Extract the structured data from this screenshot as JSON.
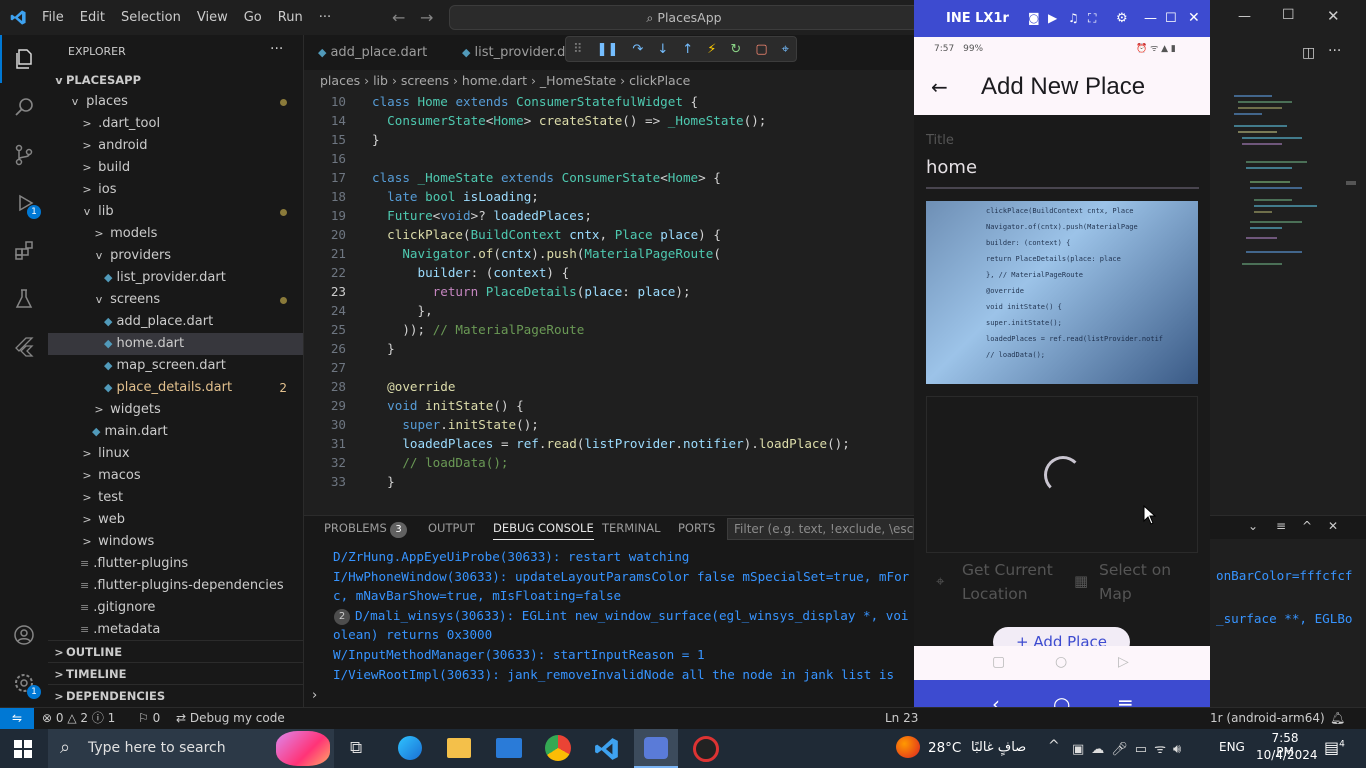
{
  "menu": [
    "File",
    "Edit",
    "Selection",
    "View",
    "Go",
    "Run",
    "···"
  ],
  "search_text": "PlacesApp",
  "explorer": {
    "title": "EXPLORER",
    "root": "PLACESAPP",
    "items": [
      {
        "label": "places",
        "depth": 1,
        "chev": "v",
        "folder": true,
        "dot": true
      },
      {
        "label": ".dart_tool",
        "depth": 2,
        "chev": ">"
      },
      {
        "label": "android",
        "depth": 2,
        "chev": ">"
      },
      {
        "label": "build",
        "depth": 2,
        "chev": ">"
      },
      {
        "label": "ios",
        "depth": 2,
        "chev": ">"
      },
      {
        "label": "lib",
        "depth": 2,
        "chev": "v",
        "dot": true
      },
      {
        "label": "models",
        "depth": 3,
        "chev": ">"
      },
      {
        "label": "providers",
        "depth": 3,
        "chev": "v"
      },
      {
        "label": "list_provider.dart",
        "depth": 4,
        "dart": true
      },
      {
        "label": "screens",
        "depth": 3,
        "chev": "v",
        "dot": true
      },
      {
        "label": "add_place.dart",
        "depth": 4,
        "dart": true
      },
      {
        "label": "home.dart",
        "depth": 4,
        "dart": true,
        "selected": true
      },
      {
        "label": "map_screen.dart",
        "depth": 4,
        "dart": true
      },
      {
        "label": "place_details.dart",
        "depth": 4,
        "dart": true,
        "badge": "2"
      },
      {
        "label": "widgets",
        "depth": 3,
        "chev": ">"
      },
      {
        "label": "main.dart",
        "depth": 3,
        "dart": true
      },
      {
        "label": "linux",
        "depth": 2,
        "chev": ">"
      },
      {
        "label": "macos",
        "depth": 2,
        "chev": ">"
      },
      {
        "label": "test",
        "depth": 2,
        "chev": ">"
      },
      {
        "label": "web",
        "depth": 2,
        "chev": ">"
      },
      {
        "label": "windows",
        "depth": 2,
        "chev": ">"
      },
      {
        "label": ".flutter-plugins",
        "depth": 2,
        "file": true
      },
      {
        "label": ".flutter-plugins-dependencies",
        "depth": 2,
        "file": true
      },
      {
        "label": ".gitignore",
        "depth": 2,
        "file": true
      },
      {
        "label": ".metadata",
        "depth": 2,
        "file": true
      }
    ],
    "sections": [
      "OUTLINE",
      "TIMELINE",
      "DEPENDENCIES"
    ]
  },
  "tabs": [
    "add_place.dart",
    "list_provider.da"
  ],
  "breadcrumb": "places › lib › screens › home.dart › _HomeState › clickPlace",
  "code": [
    {
      "n": "10",
      "html": "<span class='kw'>class</span> <span class='cl'>Home</span> <span class='kw'>extends</span> <span class='cl'>ConsumerStatefulWidget</span> <span class='pu'>{</span>"
    },
    {
      "n": "14",
      "html": "  <span class='cl'>ConsumerState</span><span class='pu'>&lt;</span><span class='cl'>Home</span><span class='pu'>&gt;</span> <span class='fn'>createState</span><span class='pu'>() =&gt;</span> <span class='cl'>_HomeState</span><span class='pu'>();</span>"
    },
    {
      "n": "15",
      "html": "<span class='pu'>}</span>"
    },
    {
      "n": "16",
      "html": ""
    },
    {
      "n": "17",
      "html": "<span class='kw'>class</span> <span class='cl'>_HomeState</span> <span class='kw'>extends</span> <span class='cl'>ConsumerState</span><span class='pu'>&lt;</span><span class='cl'>Home</span><span class='pu'>&gt; {</span>"
    },
    {
      "n": "18",
      "html": "  <span class='kw'>late</span> <span class='cl'>bool</span> <span class='vr'>isLoading</span><span class='pu'>;</span>"
    },
    {
      "n": "19",
      "html": "  <span class='cl'>Future</span><span class='pu'>&lt;</span><span class='kw'>void</span><span class='pu'>&gt;?</span> <span class='vr'>loadedPlaces</span><span class='pu'>;</span>"
    },
    {
      "n": "20",
      "html": "  <span class='fn'>clickPlace</span><span class='pu'>(</span><span class='cl'>BuildContext</span> <span class='vr'>cntx</span><span class='pu'>,</span> <span class='cl'>Place</span> <span class='vr'>place</span><span class='pu'>) {</span>"
    },
    {
      "n": "21",
      "html": "    <span class='cl'>Navigator</span><span class='pu'>.</span><span class='fn'>of</span><span class='pu'>(</span><span class='vr'>cntx</span><span class='pu'>).</span><span class='fn'>push</span><span class='pu'>(</span><span class='cl'>MaterialPageRoute</span><span class='pu'>(</span>"
    },
    {
      "n": "22",
      "html": "      <span class='vr'>builder</span><span class='pu'>: (</span><span class='vr'>context</span><span class='pu'>) {</span>"
    },
    {
      "n": "23",
      "html": "        <span class='ctl'>return</span> <span class='cl'>PlaceDetails</span><span class='pu'>(</span><span class='vr'>place</span><span class='pu'>:</span> <span class='vr'>place</span><span class='pu'>);</span>",
      "cur": true
    },
    {
      "n": "24",
      "html": "      <span class='pu'>},</span>"
    },
    {
      "n": "25",
      "html": "    <span class='pu'>));</span> <span class='cm'>// MaterialPageRoute</span>"
    },
    {
      "n": "26",
      "html": "  <span class='pu'>}</span>"
    },
    {
      "n": "27",
      "html": ""
    },
    {
      "n": "28",
      "html": "  <span class='an'>@override</span>"
    },
    {
      "n": "29",
      "html": "  <span class='kw'>void</span> <span class='fn'>initState</span><span class='pu'>() {</span>"
    },
    {
      "n": "30",
      "html": "    <span class='kw'>super</span><span class='pu'>.</span><span class='fn'>initState</span><span class='pu'>();</span>"
    },
    {
      "n": "31",
      "html": "    <span class='vr'>loadedPlaces</span> <span class='pu'>=</span> <span class='vr'>ref</span><span class='pu'>.</span><span class='fn'>read</span><span class='pu'>(</span><span class='vr'>listProvider</span><span class='pu'>.</span><span class='vr'>notifier</span><span class='pu'>).</span><span class='fn'>loadPlace</span><span class='pu'>();</span>"
    },
    {
      "n": "32",
      "html": "    <span class='cm'>// loadData();</span>"
    },
    {
      "n": "33",
      "html": "  <span class='pu'>}</span>"
    }
  ],
  "panel": {
    "tabs": [
      "PROBLEMS",
      "OUTPUT",
      "DEBUG CONSOLE",
      "TERMINAL",
      "PORTS"
    ],
    "problems_count": "3",
    "filter_placeholder": "Filter (e.g. text, !exclude, \\escape)",
    "lines": [
      "D/ZrHung.AppEyeUiProbe(30633): restart watching",
      "I/HwPhoneWindow(30633): updateLayoutParamsColor false mSpecialSet=true, mFor",
      "c, mNavBarShow=true, mIsFloating=false",
      "D/mali_winsys(30633): EGLint new_window_surface(egl_winsys_display *, voi",
      "olean) returns 0x3000",
      "W/InputMethodManager(30633): startInputReason = 1",
      "I/ViewRootImpl(30633): jank_removeInvalidNode all the node in jank list is"
    ],
    "repeat_badge": "2",
    "right_fragments": [
      "onBarColor=fffcfcf",
      "_surface **, EGLBo"
    ]
  },
  "status": {
    "errors": "0",
    "warnings": "2",
    "info": "1",
    "ports": "0",
    "debug": "Debug my code",
    "position": "Ln 23",
    "device": "1r (android-arm64)"
  },
  "emulator": {
    "title": "INE LX1r",
    "android_time": "7:57",
    "battery": "99%",
    "appbar_title": "Add New Place",
    "field_label": "Title",
    "field_value": "home",
    "btn_location": "Get Current Location",
    "btn_map": "Select on Map",
    "add_place": "+ Add Place",
    "preview_code": [
      "clickPlace(BuildContext cntx, Place",
      "Navigator.of(cntx).push(MaterialPage",
      "builder: (context) {",
      "return PlaceDetails(place: place",
      "}, // MaterialPageRoute",
      "@override",
      "void initState() {",
      "super.initState();",
      "loadedPlaces = ref.read(listProvider.notif",
      "// loadData();"
    ]
  },
  "taskbar": {
    "search": "Type here to search",
    "weather": "28°C",
    "weather_text": "صافٍ غالبًا",
    "lang": "ENG",
    "time": "7:58 PM",
    "date": "10/4/2024",
    "notif": "4"
  },
  "colors": {
    "accent": "#0078d4",
    "emulator": "#3d4bd0",
    "debug_status": "#0078d4"
  }
}
